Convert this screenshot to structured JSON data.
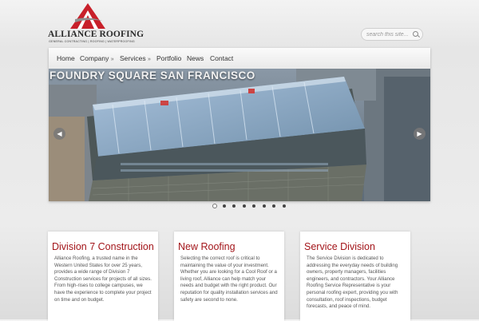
{
  "brand": {
    "name": "ALLIANCE ROOFING",
    "tagline": "GENERAL CONTRACTING | ROOFING | WATERPROOFING",
    "colors": {
      "red": "#c8202a",
      "dark": "#2b2b2b"
    }
  },
  "search": {
    "placeholder": "search this site..."
  },
  "nav": {
    "items": [
      {
        "label": "Home",
        "dropdown": false
      },
      {
        "label": "Company",
        "dropdown": true
      },
      {
        "label": "Services",
        "dropdown": true
      },
      {
        "label": "Portfolio",
        "dropdown": false
      },
      {
        "label": "News",
        "dropdown": false
      },
      {
        "label": "Contact",
        "dropdown": false
      }
    ],
    "dropdown_marker": "»"
  },
  "slider": {
    "title": "FOUNDRY SQUARE SAN FRANCISCO",
    "prev_icon": "left-arrow-icon",
    "next_icon": "right-arrow-icon",
    "slide_count": 8,
    "active_index": 0
  },
  "features": [
    {
      "title": "Division 7 Construction",
      "text": "Alliance Roofing, a trusted name in the Western United States for over 25 years, provides a wide range of Division 7 Construction services for projects of all sizes. From high-rises to college campuses, we have the experience to complete your project on time and on budget."
    },
    {
      "title": "New Roofing",
      "text": "Selecting the correct roof is critical to maintaining the value of your investment. Whether you are looking for a Cool Roof or a living roof, Alliance can help match your needs and budget with the right product. Our reputation for quality installation services and safety are second to none."
    },
    {
      "title": "Service Division",
      "text": "The Service Division is dedicated to addressing the everyday needs of building owners, property managers, facilities engineers, and contractors. Your Alliance Roofing Service Representative is your personal roofing expert, providing you with consultation, roof inspections, budget forecasts, and peace of mind."
    }
  ]
}
